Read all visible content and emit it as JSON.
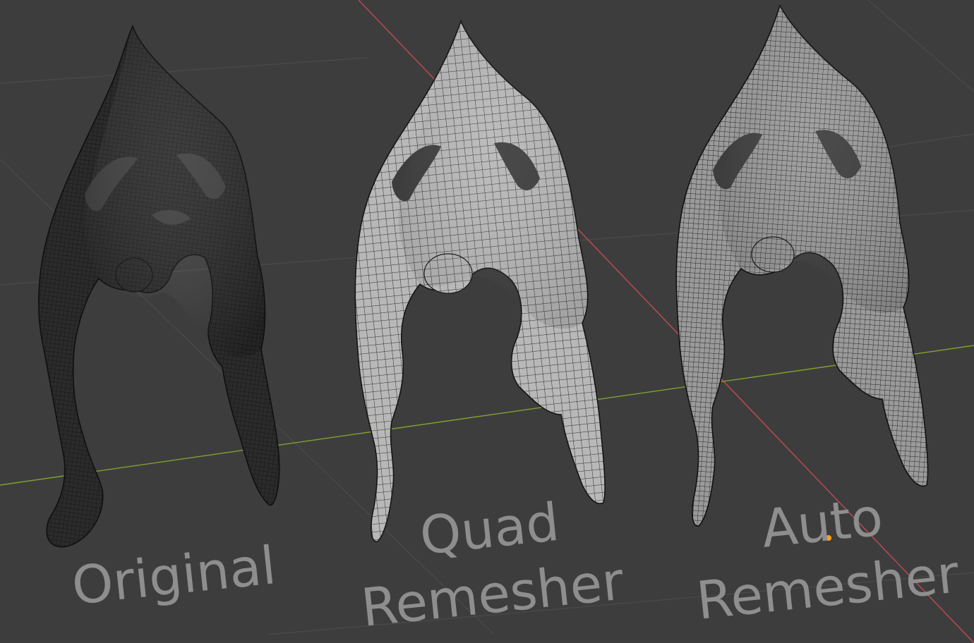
{
  "viewport": {
    "background": "#3d3d3d",
    "grid_color": "#4a4a4a",
    "x_axis_color": "#c24a55",
    "y_axis_color": "#7fa12f",
    "origin_marker_color": "#ff9f1a"
  },
  "meshes": [
    {
      "id": "original",
      "fill": "#2a2a2a",
      "wire": "#1c1c1c",
      "highlight": "#5a5a5a"
    },
    {
      "id": "quad",
      "fill": "#b9b9b9",
      "wire": "#2c2c2c",
      "highlight": "#d8d8d8"
    },
    {
      "id": "auto",
      "fill": "#8f8f8f",
      "wire": "#262626",
      "highlight": "#c4c4c4"
    }
  ],
  "labels": {
    "original": "Original",
    "quad_line1": "Quad",
    "quad_line2": "Remesher",
    "auto_line1": "Auto",
    "auto_line2": "Remesher"
  },
  "label_color": "#8e8e8e"
}
